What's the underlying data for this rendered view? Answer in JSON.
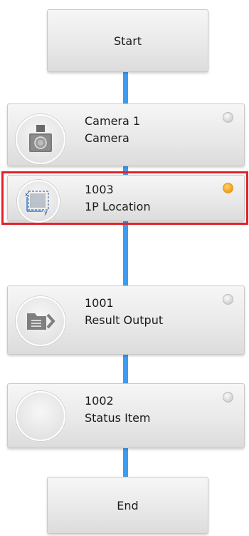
{
  "flow": {
    "start_label": "Start",
    "end_label": "End",
    "steps": [
      {
        "id": "",
        "title": "Camera 1",
        "subtitle": "Camera",
        "icon": "camera-icon",
        "status": "idle"
      },
      {
        "id": "1003",
        "title": "1003",
        "subtitle": "1P Location",
        "icon": "location-frame-icon",
        "status": "active",
        "selected": true
      },
      {
        "id": "1001",
        "title": "1001",
        "subtitle": "Result Output",
        "icon": "folder-output-icon",
        "status": "idle"
      },
      {
        "id": "1002",
        "title": "1002",
        "subtitle": "Status Item",
        "icon": "empty-circle-icon",
        "status": "idle"
      }
    ]
  },
  "colors": {
    "connector": "#3d9bf0",
    "selection": "#e0222b",
    "status_active": "#f5a623",
    "status_idle": "#d8d8d8"
  }
}
